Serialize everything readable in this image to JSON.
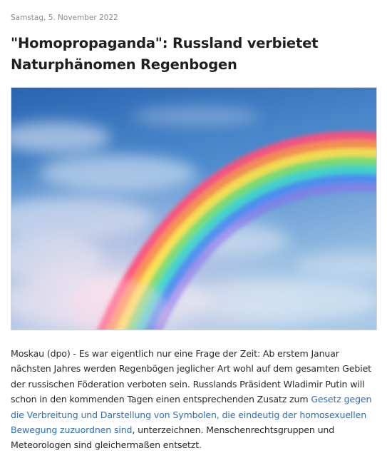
{
  "article": {
    "date": "Samstag, 5. November 2022",
    "headline": "\"Homopropaganda\": Russland verbietet Naturphänomen Regenbogen",
    "image": {
      "subject": "rainbow-over-blue-sky-with-clouds",
      "colors": {
        "sky_top": "#2f6db8",
        "sky_bottom": "#9cc2e4",
        "cloud": "#e9eff6"
      }
    },
    "body": {
      "intro": "Moskau (dpo) - Es war eigentlich nur eine Frage der Zeit: Ab erstem Januar nächsten Jahres werden Regenbögen jeglicher Art wohl auf dem gesamten Gebiet der russischen Föderation verboten sein. Russlands Präsident Wladimir Putin will schon in den kommenden Tagen einen entsprechenden Zusatz zum ",
      "link_text": "Gesetz gegen die Verbreitung und Darstellung von Symbolen, die eindeutig der homosexuellen Bewegung zuzuordnen sind",
      "outro": ", unterzeichnen. Menschenrechtsgruppen und Meteorologen sind gleichermaßen entsetzt."
    },
    "link_color": "#2f6fb3"
  }
}
